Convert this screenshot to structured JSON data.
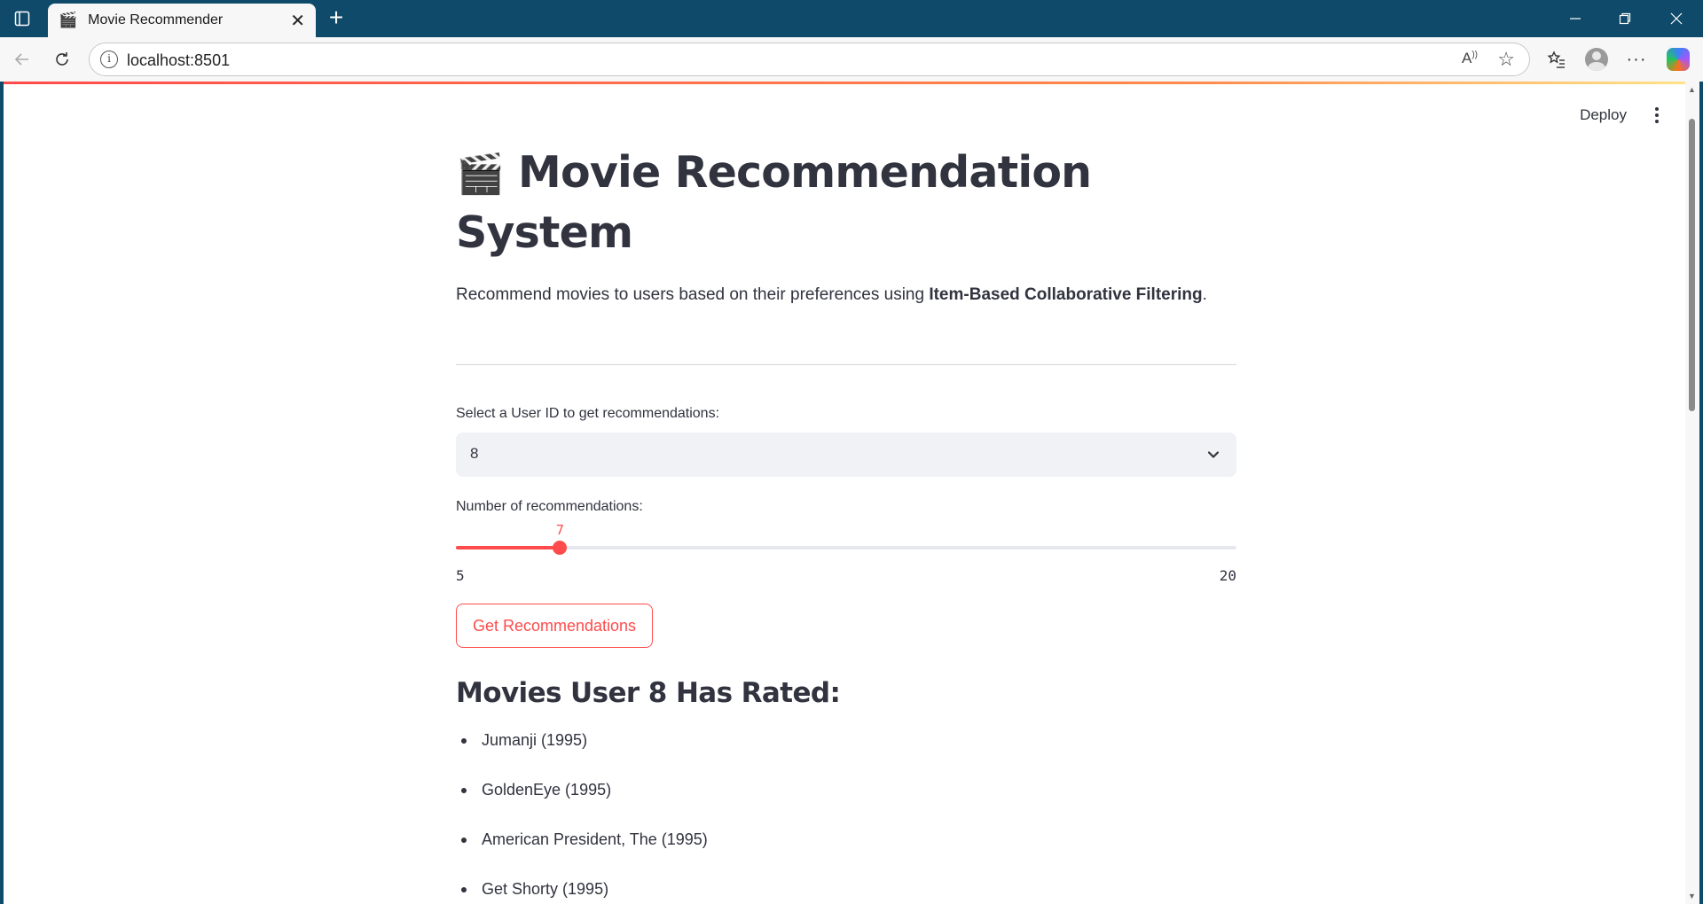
{
  "browser": {
    "tab_title": "Movie Recommender",
    "tab_favicon": "🎬",
    "url": "localhost:8501"
  },
  "app": {
    "deploy_label": "Deploy",
    "title_emoji": "🎬",
    "title": "Movie Recommendation System",
    "description_prefix": "Recommend movies to users based on their preferences using ",
    "description_bold": "Item-Based Collaborative Filtering",
    "description_suffix": ".",
    "user_select": {
      "label": "Select a User ID to get recommendations:",
      "value": "8"
    },
    "slider": {
      "label": "Number of recommendations:",
      "value": "7",
      "min": "5",
      "max": "20"
    },
    "button_label": "Get Recommendations",
    "rated_heading": "Movies User 8 Has Rated:",
    "rated_movies": [
      "Jumanji (1995)",
      "GoldenEye (1995)",
      "American President, The (1995)",
      "Get Shorty (1995)"
    ]
  },
  "colors": {
    "accent": "#ff4b4b",
    "text": "#31333f",
    "chrome": "#0f4a6a"
  }
}
